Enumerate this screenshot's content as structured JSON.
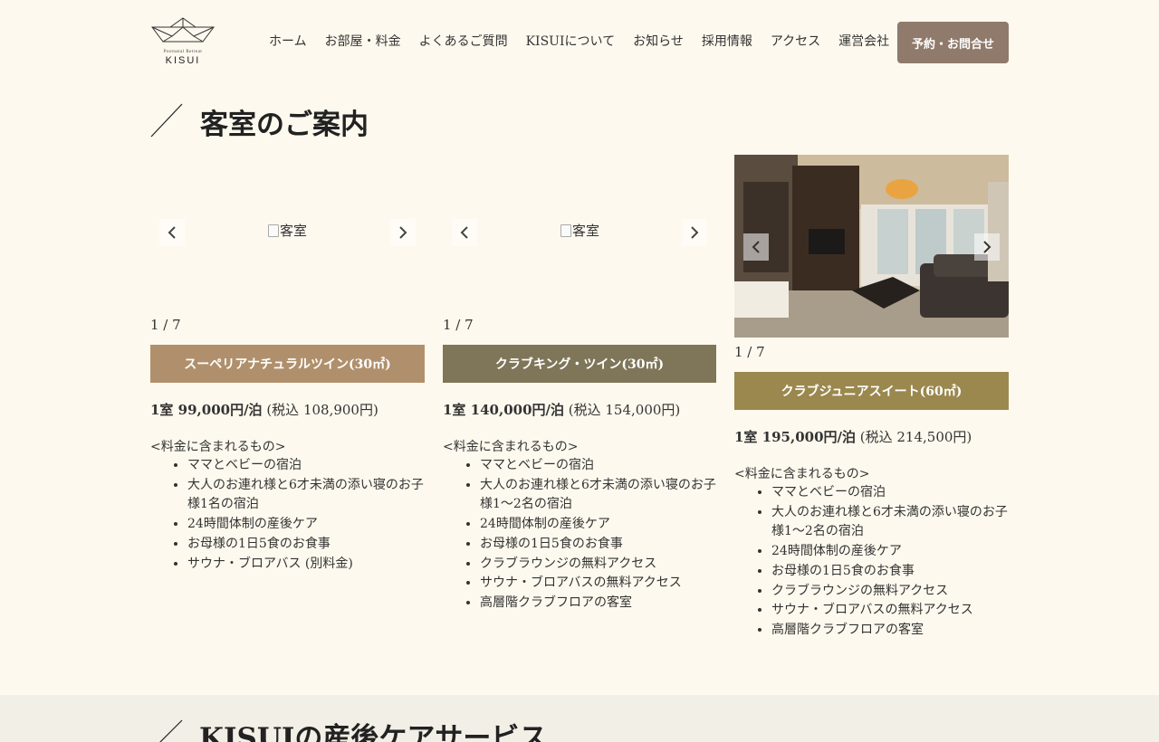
{
  "header": {
    "logo_small": "Postnatal Retreat",
    "logo_main": "KISUI",
    "nav": [
      "ホーム",
      "お部屋・料金",
      "よくあるご質問",
      "KISUIについて",
      "お知らせ",
      "採用情報",
      "アクセス",
      "運営会社"
    ],
    "cta_label": "予約・お問合せ"
  },
  "section": {
    "title": "客室のご案内"
  },
  "rooms": [
    {
      "image_alt": "客室",
      "counter": "1 / 7",
      "plan_name": "スーペリアナチュラルツイン(30㎡)",
      "plan_color": "#b0906c",
      "price_main": "1室 99,000円/泊",
      "price_tax": "(税込 108,900円)",
      "includes_label": "<料金に含まれるもの>",
      "includes": [
        "ママとベビーの宿泊",
        "大人のお連れ様と6才未満の添い寝のお子様1名の宿泊",
        "24時間体制の産後ケア",
        "お母様の1日5食のお食事",
        "サウナ・ブロアバス (別料金)"
      ]
    },
    {
      "image_alt": "客室",
      "counter": "1 / 7",
      "plan_name": "クラブキング・ツイン(30㎡)",
      "plan_color": "#7f7559",
      "price_main": "1室 140,000円/泊",
      "price_tax": "(税込 154,000円)",
      "includes_label": "<料金に含まれるもの>",
      "includes": [
        "ママとベビーの宿泊",
        "大人のお連れ様と6才未満の添い寝のお子様1〜2名の宿泊",
        "24時間体制の産後ケア",
        "お母様の1日5食のお食事",
        "クラブラウンジの無料アクセス",
        "サウナ・ブロアバスの無料アクセス",
        "高層階クラブフロアの客室"
      ]
    },
    {
      "image_alt": "客室",
      "counter": "1 / 7",
      "plan_name": "クラブジュニアスイート(60㎡)",
      "plan_color": "#9a884e",
      "price_main": "1室 195,000円/泊",
      "price_tax": "(税込 214,500円)",
      "includes_label": "<料金に含まれるもの>",
      "includes": [
        "ママとベビーの宿泊",
        "大人のお連れ様と6才未満の添い寝のお子様1〜2名の宿泊",
        "24時間体制の産後ケア",
        "お母様の1日5食のお食事",
        "クラブラウンジの無料アクセス",
        "サウナ・ブロアバスの無料アクセス",
        "高層階クラブフロアの客室"
      ]
    }
  ],
  "next_section": {
    "title": "KISUIの産後ケアサービス"
  }
}
